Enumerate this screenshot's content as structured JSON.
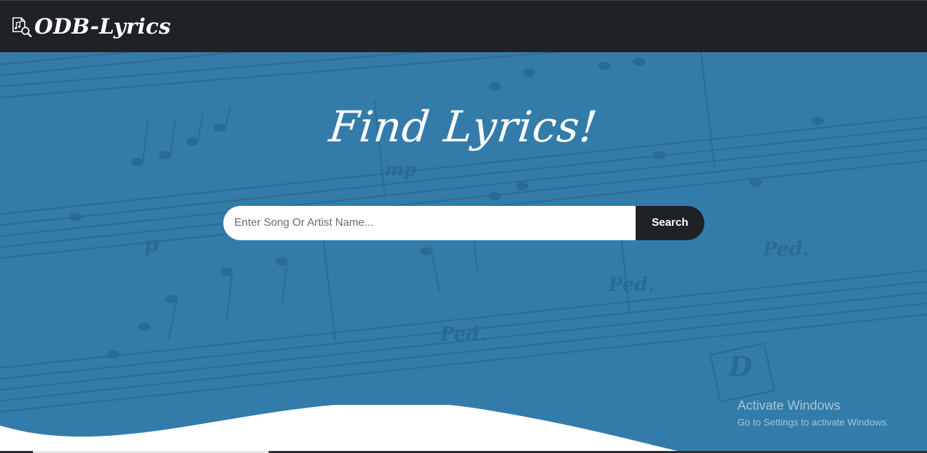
{
  "navbar": {
    "brand": "ODB-Lyrics",
    "brand_icon": "music-file-search-icon"
  },
  "hero": {
    "title": "Find Lyrics!",
    "search": {
      "placeholder": "Enter Song Or Artist Name...",
      "value": "",
      "button_label": "Search"
    },
    "background_color": "#337ca9"
  },
  "watermark": {
    "title": "Activate Windows",
    "subtitle": "Go to Settings to activate Windows."
  },
  "colors": {
    "navbar": "#1e2226",
    "hero": "#337ca9",
    "button": "#1e2226",
    "text": "#ffffff"
  }
}
